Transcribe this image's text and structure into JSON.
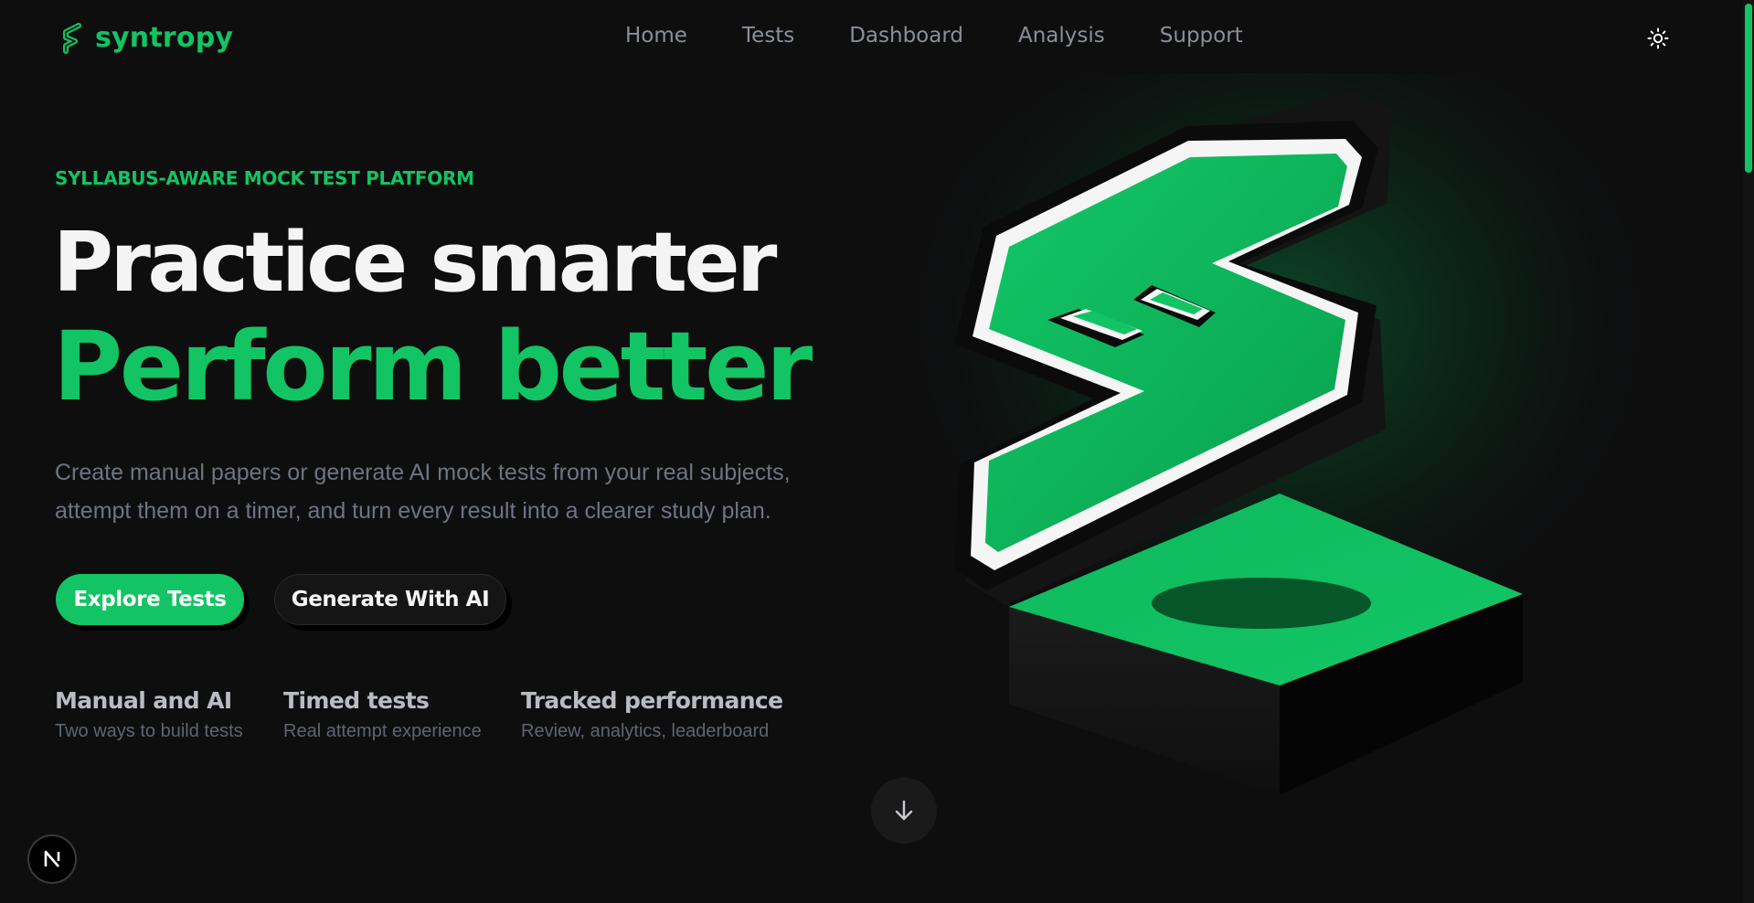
{
  "brand": {
    "name": "syntropy",
    "accent": "#12c463",
    "icon": "syntropy-s-logo-icon"
  },
  "nav": {
    "items": [
      {
        "label": "Home"
      },
      {
        "label": "Tests"
      },
      {
        "label": "Dashboard"
      },
      {
        "label": "Analysis"
      },
      {
        "label": "Support"
      }
    ],
    "theme_toggle_icon": "sun-icon"
  },
  "hero": {
    "eyebrow": "SYLLABUS-AWARE MOCK TEST PLATFORM",
    "title_line1": "Practice smarter",
    "title_line2": "Perform better",
    "subtitle_line1": "Create manual papers or generate AI mock tests from your real subjects,",
    "subtitle_line2": "attempt them on a timer, and turn every result into a clearer study plan.",
    "primary_cta": "Explore Tests",
    "secondary_cta": "Generate With AI"
  },
  "features": [
    {
      "title": "Manual and AI",
      "subtitle": "Two ways to build tests"
    },
    {
      "title": "Timed tests",
      "subtitle": "Real attempt experience"
    },
    {
      "title": "Tracked performance",
      "subtitle": "Review, analytics, leaderboard"
    }
  ],
  "scroll_down_icon": "arrow-down-icon",
  "dev_badge": {
    "label": "N",
    "icon": "nextjs-badge-icon"
  },
  "colors": {
    "background": "#0e0e0f",
    "accent": "#12c463",
    "text_primary": "#f4f4f5",
    "text_muted": "#6e7480"
  }
}
